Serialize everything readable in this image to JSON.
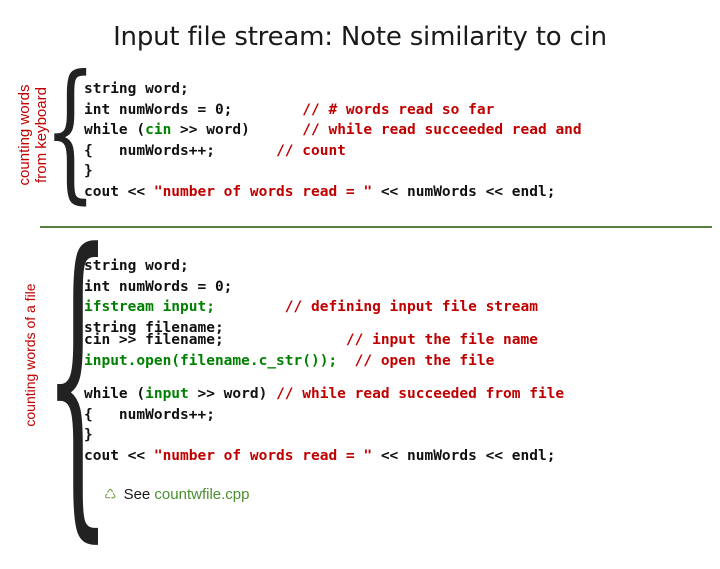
{
  "slide": {
    "title": "Input file stream: Note similarity to cin",
    "labels": {
      "left_top_line1": "counting words",
      "left_top_line2": "from keyboard",
      "left_bottom": "counting words of a file"
    },
    "code_block_1": [
      {
        "segments": [
          {
            "text": "string word;",
            "style": "plain"
          }
        ]
      },
      {
        "segments": [
          {
            "text": "int numWords = 0;",
            "style": "plain"
          },
          {
            "text": "        ",
            "style": "plain"
          },
          {
            "text": "// # words read so far",
            "style": "cmt"
          }
        ]
      },
      {
        "segments": [
          {
            "text": "while (",
            "style": "plain"
          },
          {
            "text": "cin",
            "style": "kw"
          },
          {
            "text": " >> word)",
            "style": "plain"
          },
          {
            "text": "      ",
            "style": "plain"
          },
          {
            "text": "// while read succeeded read and",
            "style": "cmt"
          }
        ]
      },
      {
        "segments": [
          {
            "text": "{   numWords++;",
            "style": "plain"
          },
          {
            "text": "       ",
            "style": "plain"
          },
          {
            "text": "// count",
            "style": "cmt"
          }
        ]
      },
      {
        "segments": [
          {
            "text": "}",
            "style": "plain"
          }
        ]
      },
      {
        "segments": [
          {
            "text": "cout << ",
            "style": "plain"
          },
          {
            "text": "\"number of words read = \"",
            "style": "str"
          },
          {
            "text": " << numWords << endl;",
            "style": "plain"
          }
        ]
      }
    ],
    "code_block_2": [
      {
        "segments": [
          {
            "text": "string word;",
            "style": "plain"
          }
        ]
      },
      {
        "segments": [
          {
            "text": "int numWords = 0;",
            "style": "plain"
          }
        ]
      },
      {
        "segments": [
          {
            "text": "ifstream input;",
            "style": "kw"
          },
          {
            "text": "        ",
            "style": "plain"
          },
          {
            "text": "// defining input file stream",
            "style": "cmt"
          }
        ]
      },
      {
        "segments": [
          {
            "text": "string filename;",
            "style": "plain"
          }
        ]
      }
    ],
    "code_block_3": [
      {
        "segments": [
          {
            "text": "cin >> filename;",
            "style": "plain"
          },
          {
            "text": "              ",
            "style": "plain"
          },
          {
            "text": "// input the file name",
            "style": "cmt"
          }
        ]
      },
      {
        "segments": [
          {
            "text": "input.open(filename.c_str());",
            "style": "kw"
          },
          {
            "text": "  ",
            "style": "plain"
          },
          {
            "text": "// open the file",
            "style": "cmt"
          }
        ]
      }
    ],
    "code_block_4": [
      {
        "segments": [
          {
            "text": "while (",
            "style": "plain"
          },
          {
            "text": "input",
            "style": "kw"
          },
          {
            "text": " >> word) ",
            "style": "plain"
          },
          {
            "text": "// while read succeeded from file",
            "style": "cmt"
          }
        ]
      },
      {
        "segments": [
          {
            "text": "{   numWords++;",
            "style": "plain"
          }
        ]
      },
      {
        "segments": [
          {
            "text": "}",
            "style": "plain"
          }
        ]
      },
      {
        "segments": [
          {
            "text": "cout << ",
            "style": "plain"
          },
          {
            "text": "\"number of words read = \"",
            "style": "str"
          },
          {
            "text": " << numWords << endl;",
            "style": "plain"
          }
        ]
      }
    ],
    "footnote": {
      "bullet": "♺",
      "text": "See ",
      "link": "countwfile.cpp"
    },
    "brace_glyph": "{",
    "colors": {
      "comment_red": "#c00000",
      "keyword_green": "#008000",
      "label_red": "#c00000",
      "rule_green": "#5b7f3f",
      "link_green": "#4a8f2f"
    }
  }
}
